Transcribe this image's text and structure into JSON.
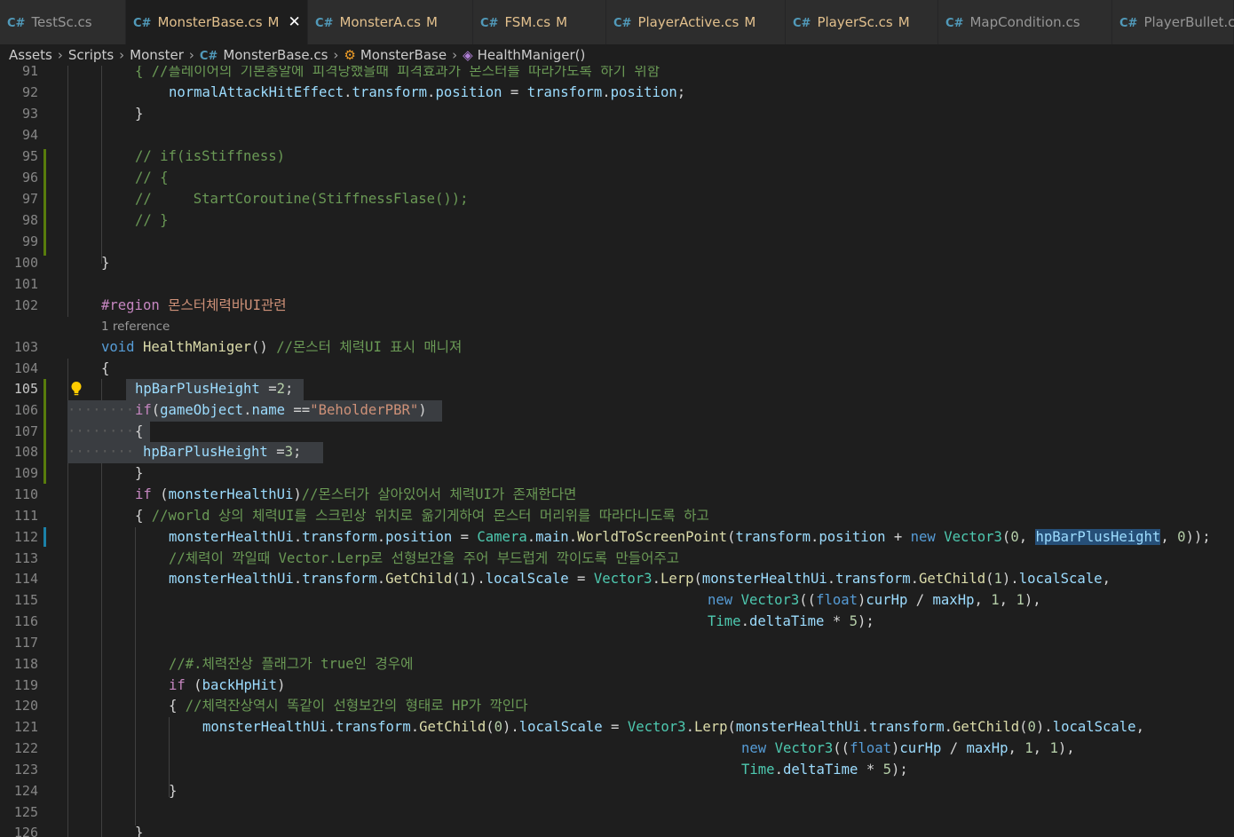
{
  "tabs": [
    {
      "label": "TestSc.cs",
      "badge": ""
    },
    {
      "label": "MonsterBase.cs",
      "badge": "M",
      "active": true
    },
    {
      "label": "MonsterA.cs",
      "badge": "M"
    },
    {
      "label": "FSM.cs",
      "badge": "M"
    },
    {
      "label": "PlayerActive.cs",
      "badge": "M"
    },
    {
      "label": "PlayerSc.cs",
      "badge": "M"
    },
    {
      "label": "MapCondition.cs",
      "badge": ""
    },
    {
      "label": "PlayerBullet.cs",
      "badge": ""
    }
  ],
  "icons": {
    "csharp": "C#",
    "close": "✕"
  },
  "breadcrumb": {
    "assets": "Assets",
    "scripts": "Scripts",
    "monster": "Monster",
    "file": "MonsterBase.cs",
    "class": "MonsterBase",
    "method": "HealthManiger()"
  },
  "codelens": "1 reference",
  "lines": {
    "l91": {
      "num": "91",
      "text": "{ //플레이어의 기본총알에 피격당했을때 피격효과가 몬스터를 따라가도록 하기 위함"
    },
    "l92": {
      "num": "92",
      "t1": "normalAttackHitEffect",
      "t2": ".",
      "t3": "transform",
      "t4": ".",
      "t5": "position",
      "t6": " = ",
      "t7": "transform",
      "t8": ".",
      "t9": "position",
      "t10": ";"
    },
    "l93": {
      "num": "93",
      "text": "}"
    },
    "l94": {
      "num": "94"
    },
    "l95": {
      "num": "95",
      "text": "// if(isStiffness)"
    },
    "l96": {
      "num": "96",
      "text": "// {"
    },
    "l97": {
      "num": "97",
      "text": "//     StartCoroutine(StiffnessFlase());"
    },
    "l98": {
      "num": "98",
      "text": "// }"
    },
    "l99": {
      "num": "99"
    },
    "l100": {
      "num": "100",
      "text": "}"
    },
    "l101": {
      "num": "101"
    },
    "l102": {
      "num": "102",
      "t1": "#region",
      "t2": " 몬스터체력바UI관련"
    },
    "l103": {
      "num": "103",
      "t1": "void",
      "t2": " ",
      "t3": "HealthManiger",
      "t4": "() ",
      "t5": "//몬스터 체력UI 표시 매니져"
    },
    "l104": {
      "num": "104",
      "text": "{"
    },
    "l105": {
      "num": "105",
      "t1": "hpBarPlusHeight",
      "t2": " =",
      "t3": "2",
      "t4": ";"
    },
    "l106": {
      "num": "106",
      "t1": "if",
      "t2": "(",
      "t3": "gameObject",
      "t4": ".",
      "t5": "name",
      "t6": " ==",
      "t7": "\"BeholderPBR\"",
      "t8": ")"
    },
    "l107": {
      "num": "107",
      "text": "{"
    },
    "l108": {
      "num": "108",
      "t1": "hpBarPlusHeight",
      "t2": " =",
      "t3": "3",
      "t4": ";"
    },
    "l109": {
      "num": "109",
      "text": "}"
    },
    "l110": {
      "num": "110",
      "t1": "if",
      "t2": " (",
      "t3": "monsterHealthUi",
      "t4": ")",
      "t5": "//몬스터가 살아있어서 체력UI가 존재한다면"
    },
    "l111": {
      "num": "111",
      "t1": "{ ",
      "t2": "//world 상의 체력UI를 스크린상 위치로 옮기게하여 몬스터 머리위를 따라다니도록 하고"
    },
    "l112": {
      "num": "112",
      "t1": "monsterHealthUi",
      "t2": ".",
      "t3": "transform",
      "t4": ".",
      "t5": "position",
      "t6": " = ",
      "t7": "Camera",
      "t8": ".",
      "t9": "main",
      "t10": ".",
      "t11": "WorldToScreenPoint",
      "t12": "(",
      "t13": "transform",
      "t14": ".",
      "t15": "position",
      "t16": " + ",
      "t17": "new",
      "t18": " ",
      "t19": "Vector3",
      "t20": "(",
      "t21": "0",
      "t22": ", ",
      "t23": "hpBarPlusHeight",
      "t24": ", ",
      "t25": "0",
      "t26": "));"
    },
    "l113": {
      "num": "113",
      "text": "//체력이 깍일때 Vector.Lerp로 선형보간을 주어 부드럽게 깍이도록 만들어주고"
    },
    "l114": {
      "num": "114",
      "t1": "monsterHealthUi",
      "t2": ".",
      "t3": "transform",
      "t4": ".",
      "t5": "GetChild",
      "t6": "(",
      "t7": "1",
      "t8": ").",
      "t9": "localScale",
      "t10": " = ",
      "t11": "Vector3",
      "t12": ".",
      "t13": "Lerp",
      "t14": "(",
      "t15": "monsterHealthUi",
      "t16": ".",
      "t17": "transform",
      "t18": ".",
      "t19": "GetChild",
      "t20": "(",
      "t21": "1",
      "t22": ").",
      "t23": "localScale",
      "t24": ","
    },
    "l115": {
      "num": "115",
      "t1": "new",
      "t2": " ",
      "t3": "Vector3",
      "t4": "((",
      "t5": "float",
      "t6": ")",
      "t7": "curHp",
      "t8": " / ",
      "t9": "maxHp",
      "t10": ", ",
      "t11": "1",
      "t12": ", ",
      "t13": "1",
      "t14": "),"
    },
    "l116": {
      "num": "116",
      "t1": "Time",
      "t2": ".",
      "t3": "deltaTime",
      "t4": " * ",
      "t5": "5",
      "t6": ");"
    },
    "l117": {
      "num": "117"
    },
    "l118": {
      "num": "118",
      "text": "//#.체력잔상 플래그가 true인 경우에"
    },
    "l119": {
      "num": "119",
      "t1": "if",
      "t2": " (",
      "t3": "backHpHit",
      "t4": ")"
    },
    "l120": {
      "num": "120",
      "t1": "{ ",
      "t2": "//체력잔상역시 똑같이 선형보간의 형태로 HP가 깍인다"
    },
    "l121": {
      "num": "121",
      "t1": "monsterHealthUi",
      "t2": ".",
      "t3": "transform",
      "t4": ".",
      "t5": "GetChild",
      "t6": "(",
      "t7": "0",
      "t8": ").",
      "t9": "localScale",
      "t10": " = ",
      "t11": "Vector3",
      "t12": ".",
      "t13": "Lerp",
      "t14": "(",
      "t15": "monsterHealthUi",
      "t16": ".",
      "t17": "transform",
      "t18": ".",
      "t19": "GetChild",
      "t20": "(",
      "t21": "0",
      "t22": ").",
      "t23": "localScale",
      "t24": ","
    },
    "l122": {
      "num": "122",
      "t1": "new",
      "t2": " ",
      "t3": "Vector3",
      "t4": "((",
      "t5": "float",
      "t6": ")",
      "t7": "curHp",
      "t8": " / ",
      "t9": "maxHp",
      "t10": ", ",
      "t11": "1",
      "t12": ", ",
      "t13": "1",
      "t14": "),"
    },
    "l123": {
      "num": "123",
      "t1": "Time",
      "t2": ".",
      "t3": "deltaTime",
      "t4": " * ",
      "t5": "5",
      "t6": ");"
    },
    "l124": {
      "num": "124",
      "text": "}"
    },
    "l125": {
      "num": "125"
    },
    "l126": {
      "num": "126",
      "text": "}"
    }
  }
}
